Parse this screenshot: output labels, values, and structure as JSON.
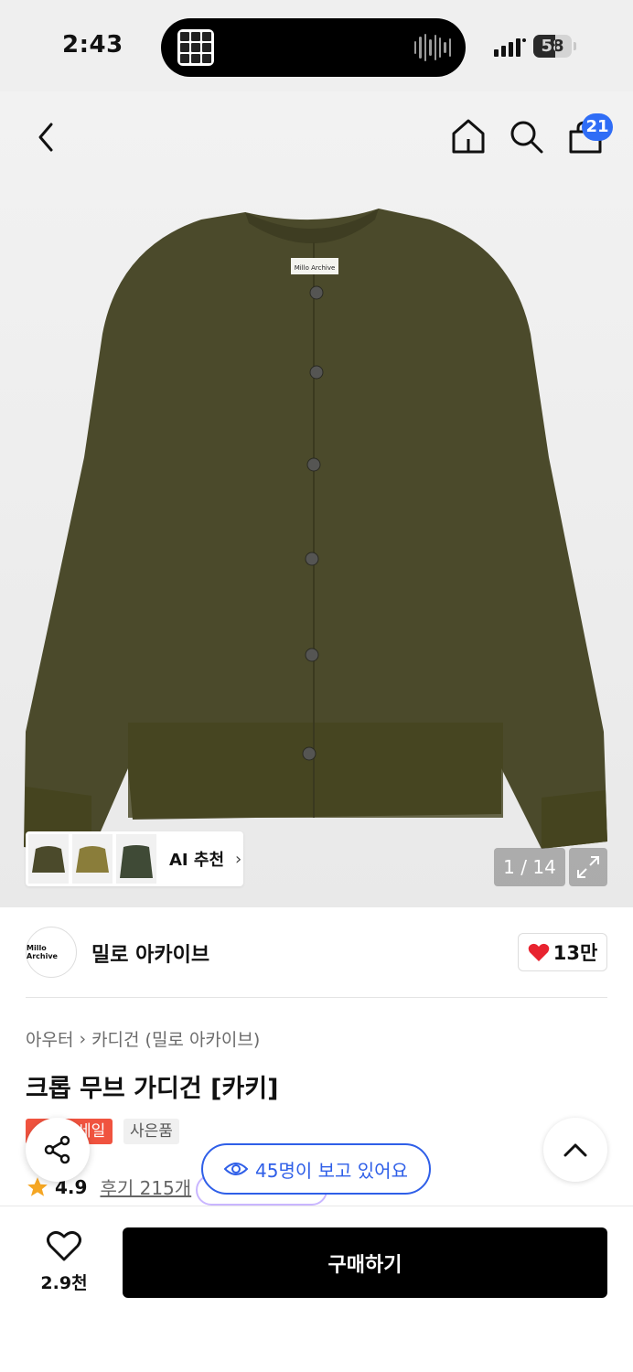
{
  "status_bar": {
    "time": "2:43",
    "battery": "58",
    "battery_level": 0.58
  },
  "nav": {
    "cart_count": "21"
  },
  "product_image": {
    "label_tag": "Millo Archive",
    "counter": "1 / 14",
    "ai_recommend": "AI 추천",
    "garment_color": "#4b4a2b"
  },
  "brand": {
    "logo_text": "Millo Archive",
    "name": "밀로 아카이브",
    "likes": "13만"
  },
  "breadcrumb": {
    "category": "아우터",
    "sub": "카디건 (밀로 아카이브)"
  },
  "product": {
    "title": "크롭 무브 가디건 [카키]",
    "sale_tag": "세일",
    "gift_tag": "사은품",
    "rating": "4.9",
    "reviews": "후기 215개",
    "viewers": "45명이 보고 있어요"
  },
  "bottom": {
    "wish_count": "2.9천",
    "buy_label": "구매하기"
  },
  "colors": {
    "accent_blue": "#2f5fe8",
    "sale_red": "#f0533f",
    "heart_red": "#e8232f"
  }
}
